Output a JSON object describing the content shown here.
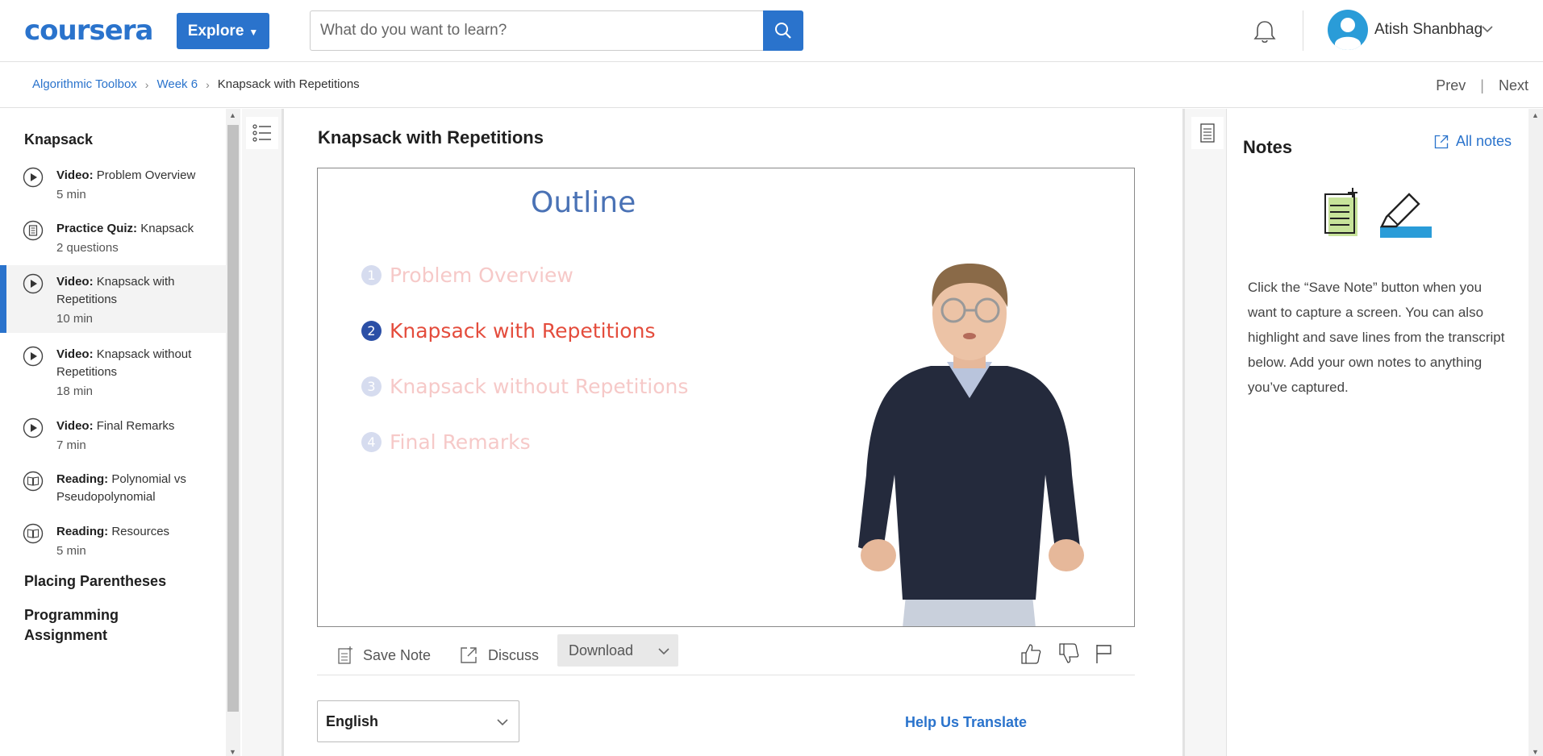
{
  "header": {
    "logo": "coursera",
    "explore_label": "Explore",
    "search_placeholder": "What do you want to learn?",
    "user_name": "Atish Shanbhag"
  },
  "breadcrumb": {
    "items": [
      "Algorithmic Toolbox",
      "Week 6",
      "Knapsack with Repetitions"
    ],
    "prev": "Prev",
    "next": "Next",
    "sep": "|"
  },
  "sidebar": {
    "module_title": "Knapsack",
    "items": [
      {
        "type": "Video:",
        "title": "Problem Overview",
        "duration": "5 min",
        "icon": "play-icon"
      },
      {
        "type": "Practice Quiz:",
        "title": "Knapsack",
        "duration": "2 questions",
        "icon": "quiz-icon"
      },
      {
        "type": "Video:",
        "title": "Knapsack with Repetitions",
        "duration": "10 min",
        "icon": "play-icon",
        "active": true
      },
      {
        "type": "Video:",
        "title": "Knapsack without Repetitions",
        "duration": "18 min",
        "icon": "play-icon"
      },
      {
        "type": "Video:",
        "title": "Final Remarks",
        "duration": "7 min",
        "icon": "play-icon"
      },
      {
        "type": "Reading:",
        "title": "Polynomial vs Pseudopolynomial",
        "duration": "",
        "icon": "book-icon"
      },
      {
        "type": "Reading:",
        "title": "Resources",
        "duration": "5 min",
        "icon": "book-icon"
      }
    ],
    "other_modules": [
      "Placing Parentheses",
      "Programming Assignment"
    ]
  },
  "main": {
    "title": "Knapsack with Repetitions",
    "video": {
      "heading": "Outline",
      "items": [
        {
          "num": "1",
          "label": "Problem Overview",
          "state": "faded"
        },
        {
          "num": "2",
          "label": "Knapsack with Repetitions",
          "state": "current"
        },
        {
          "num": "3",
          "label": "Knapsack without Repetitions",
          "state": "faded"
        },
        {
          "num": "4",
          "label": "Final Remarks",
          "state": "faded"
        }
      ]
    },
    "toolbar": {
      "save_note": "Save Note",
      "discuss": "Discuss",
      "download": "Download"
    },
    "language": "English",
    "help_translate": "Help Us Translate"
  },
  "notes": {
    "title": "Notes",
    "all_notes": "All notes",
    "help_text": "Click the “Save Note” button when you want to capture a screen. You can also highlight and save lines from the transcript below. Add your own notes to anything you’ve captured."
  },
  "colors": {
    "brand": "#2a73cc",
    "active_highlight": "#e44c3c",
    "sidebar_active_bg": "#f3f3f3"
  }
}
